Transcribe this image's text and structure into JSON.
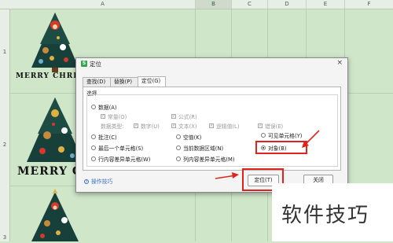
{
  "spreadsheet": {
    "columns": [
      "A",
      "B",
      "C",
      "D",
      "E",
      "F"
    ],
    "selected_column": "B",
    "row_numbers": [
      "1",
      "2",
      "3"
    ],
    "decoration_text": "MERRY CHRISTMAS"
  },
  "dialog": {
    "title": "定位",
    "app_icon": "S",
    "close": "×",
    "tabs": [
      "查找(D)",
      "替换(P)",
      "定位(G)"
    ],
    "active_tab": "定位(G)",
    "group_label": "选择",
    "options": {
      "data": "数据(A)",
      "constant": "常量(O)",
      "formula": "公式(R)",
      "data_type_label": "数据类型:",
      "number": "数字(U)",
      "text": "文本(X)",
      "logical": "逻辑值(L)",
      "error": "错误(E)",
      "comments": "批注(C)",
      "blanks": "空值(K)",
      "visible_cells": "可见单元格(Y)",
      "last_cell": "最后一个单元格(S)",
      "current_region": "当前数据区域(N)",
      "objects": "对象(B)",
      "row_differences": "行内容差异单元格(W)",
      "column_differences": "列内容差异单元格(M)"
    },
    "selected_option": "对象(B)",
    "tips_link": "操作技巧",
    "buttons": {
      "locate": "定位(T)",
      "close": "关闭"
    }
  },
  "watermark": "软件技巧",
  "colors": {
    "highlight": "#e0241b",
    "sheet_bg": "#cfe6c9",
    "link": "#3a6fc4"
  }
}
